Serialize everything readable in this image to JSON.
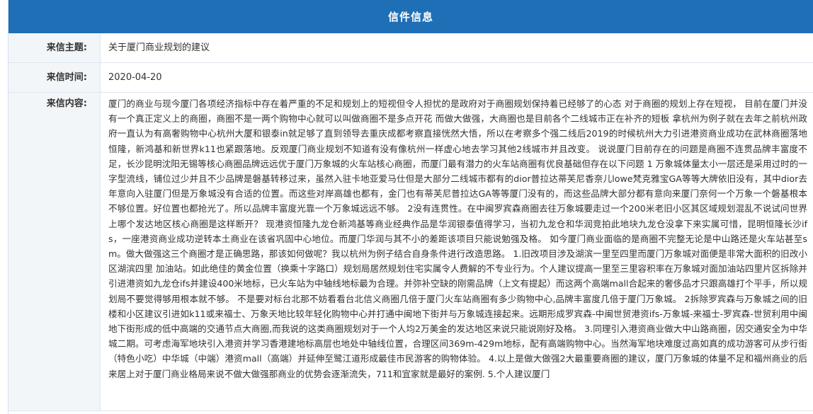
{
  "panel": {
    "title": "信件信息"
  },
  "fields": {
    "subject_label": "来信主题:",
    "subject_value": "关于厦门商业规划的建议",
    "date_label": "来信时间:",
    "date_value": "2020-04-20",
    "content_label": "来信内容:",
    "content_value": "厦门的商业与现今厦门各项经济指标中存在着严重的不足和规划上的短视但令人担忧的是政府对于商圈规划保持着已经够了的心态 对于商圈的规划上存在短视， 目前在厦门并没有一个真正定义上的商圈，商圈不是一两个购物中心就可以叫做商圈不是多点开花 而做大做强，大商圈也是目前各个二线城市正在补齐的短板 拿杭州为例子就在去年之前杭州政府一直认为有高奢购物中心杭州大厦和银泰in就足够了直到领导去重庆成都考察直接恍然大悟，所以在考察多个强二线后2019的时候杭州大力引进港资商业成功在武林商圈落地恒隆，新鸿基和新世界k11也紧跟落地。反观厦门商业规划不知道有没有像杭州一样虚心地去学习其他2线城市并且改变。 说说厦门目前存在的问题是商圈不连贯品牌丰富度不足，长沙昆明沈阳无锡等核心商圈品牌远远优于厦门万象城的火车站核心商圈，而厦门最有潜力的火车站商圈有优良基础但存在以下问题 1 万象城体量太小一层还是采用过时的一字型流线，铺位过少并且不少品牌是磐基转移过来，虽然入驻卡地亚爱马仕但是大部分二线城市都有的dior普拉达蒂芙尼香奈儿lowe梵克雅宝GA等等大牌依旧没有，其中dior去年意向入驻厦门但是万象城没有合适的位置。而这些对岸高雄也都有，金门也有蒂芙尼普拉达GA等等厦门没有的，而这些品牌大部分都有意向来厦门奈何一个万象一个磐基根本不够位置。好位置也都抢光了。所以品牌丰富度光靠一个万象城远远不够。 2没有连贯性。在中闽罗宾森商圈去往万象城要走过一个200米老旧小区其区域规划混乱不说试问世界上哪个发达地区核心商圈是这样断开？ 现港资恒隆九龙仓新鸿基等商业经典作品是华润银泰值得学习，当初九龙仓和华润竞拍此地块九龙仓没拿下来实属可惜，昆明恒隆长沙ifs，一座港资商业成功逆转本土商业在该省巩固中心地位。而厦门华润与其不小的差距该项目只能说勉强及格。 如今厦门商业面临的是商圈不完整无论是中山路还是火车站甚至sm。做大做强这三个商圈才是正确思路，那该如何做呢？我以杭州为例子结合自身条件进行改造思路。 1.旧改项目涉及湖滨一里至四里而厦门万象城对面便是非常大面积的旧改小区湖滨四里 加油站。如此绝佳的黄金位置（换乘十字路口）规划局居然规划住宅实属令人费解的不专业行为。个人建议提高一里至三里容积率在万象城对面加油站四里片区拆除并引进港资如九龙仓ifs并建设400米地标，已火车站为中轴线地标最为合理。并弥补空缺的刚需品牌（上文有提起）而这两个高端mall合起来的奢侈品才只跟高雄打个平手，所以规划局不要觉得够用根本就不够。 不是要对标台北那不妨看看台北信义商圈几倍于厦门火车站商圈有多少购物中心,品牌丰富度几倍于厦门万象城。 2拆除罗宾森与万象城之间的旧楼和小区建议引进如k11或来福士、万象天地比较年轻化购物中心并打通中闽地下街并与万象城连接起来。远期形成罗宾森-中闽世贸港资ifs-万象城-来福士-罗宾森-世贸利用中闽地下街形成的低中高端的交通节点大商圈,而我说的这类商圈规划对于一个人均2万美金的发达地区来说只能说刚好及格。 3.同理引入港资商业做大中山路商圈，因交通安全为中华城二期。可考虑海军地块引入港资并学习香港建地标高层也地处中轴线位置，合理区间369m-429m地标，配有高端购物中心。当然海军地块难度过高如真的成功游客可从步行街（特色小吃）中华城（中端）港资mall（高端）并延伸至鹭江道形成最佳市民游客的购物体验。 4.以上是做大做强2大最重要商圈的建议，厦门万象城的体量不足和福州商业的后来居上对于厦门商业格局来说不做大做强那商业的优势会逐渐流失，711和宜家就是最好的案例. 5.个人建议厦门"
  }
}
